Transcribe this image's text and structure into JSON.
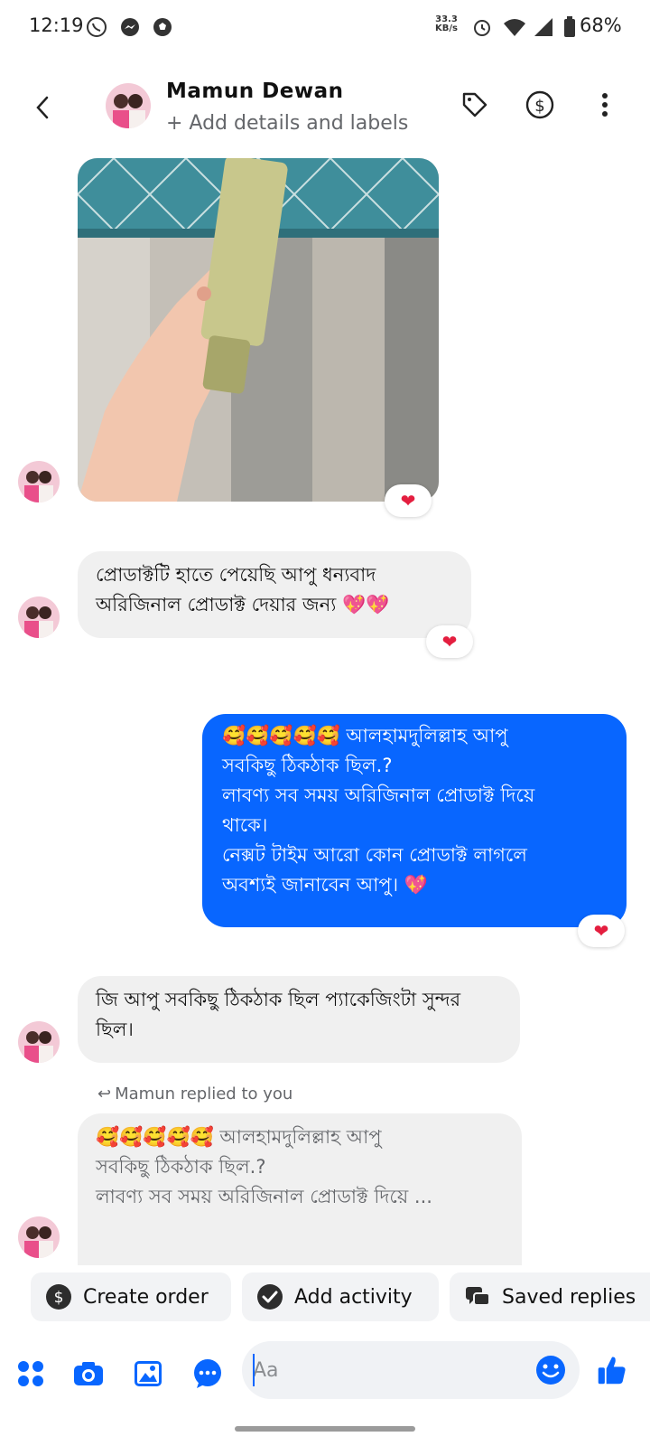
{
  "status_bar": {
    "time": "12:19",
    "net_speed_value": "33.3",
    "net_speed_unit": "KB/s",
    "battery": "68%"
  },
  "header": {
    "contact_name": "Mamun Dewan",
    "subtitle": "+ Add details and labels"
  },
  "messages": [
    {
      "type": "photo",
      "direction": "in",
      "reaction": "heart"
    },
    {
      "type": "text",
      "direction": "in",
      "text": "প্রোডাক্টটি হাতে পেয়েছি আপু ধন্যবাদ অরিজিনাল প্রোডাক্ট দেয়ার জন্য 💖💖",
      "reaction": "heart"
    },
    {
      "type": "text",
      "direction": "out",
      "lines": [
        "🥰🥰🥰🥰🥰 আলহামদুলিল্লাহ আপু",
        "সবকিছু ঠিকঠাক ছিল.?",
        "লাবণ্য সব সময় অরিজিনাল প্রোডাক্ট দিয়ে",
        "থাকে।",
        "নেক্সট টাইম আরো কোন প্রোডাক্ট লাগলে",
        "অবশ্যই জানাবেন আপু। 💖"
      ],
      "reaction": "heart"
    },
    {
      "type": "text",
      "direction": "in",
      "text": "জি আপু সবকিছু ঠিকঠাক ছিল প্যাকেজিংটা সুন্দর ছিল।"
    },
    {
      "type": "reply",
      "direction": "in",
      "reply_label": "Mamun replied to you",
      "quoted_lines": [
        "🥰🥰🥰🥰🥰 আলহামদুলিল্লাহ আপু",
        "সবকিছু ঠিকঠাক ছিল.?",
        "লাবণ্য সব সময় অরিজিনাল প্রোডাক্ট দিয়ে ..."
      ]
    }
  ],
  "quick_actions": {
    "create_order": "Create order",
    "add_activity": "Add activity",
    "saved_replies": "Saved replies"
  },
  "composer": {
    "placeholder": "Aa"
  },
  "colors": {
    "accent": "#0866ff",
    "bubble_in": "#f0f0f0",
    "heart": "#e41e3f"
  },
  "icons": [
    "whatsapp-icon",
    "messenger-icon",
    "soccer-icon",
    "alarm-icon",
    "wifi-icon",
    "signal-icon",
    "battery-icon",
    "back-icon",
    "tag-icon",
    "dollar-icon",
    "more-icon",
    "grid-icon",
    "camera-icon",
    "gallery-icon",
    "chat-bubble-icon",
    "emoji-icon",
    "thumbs-up-icon"
  ]
}
